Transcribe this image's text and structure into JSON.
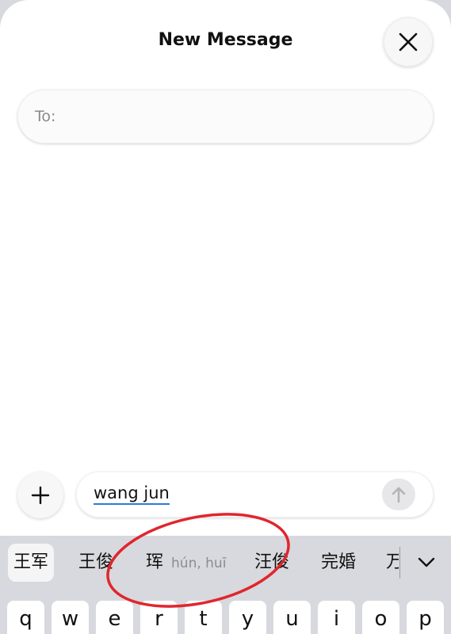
{
  "header": {
    "title": "New Message",
    "close_icon": "close-icon"
  },
  "recipient": {
    "label": "To:"
  },
  "composer": {
    "plus_icon": "plus-icon",
    "text": "wang jun",
    "send_icon": "arrow-up-icon"
  },
  "keyboard": {
    "candidates": [
      {
        "text": "王军",
        "pinyin": ""
      },
      {
        "text": "王俊",
        "pinyin": ""
      },
      {
        "text": "珲",
        "pinyin": "hún, huī"
      },
      {
        "text": "汪俊",
        "pinyin": ""
      },
      {
        "text": "完婚",
        "pinyin": ""
      },
      {
        "text": "万",
        "pinyin": ""
      }
    ],
    "expand_icon": "chevron-down-icon",
    "row1": [
      "q",
      "w",
      "e",
      "r",
      "t",
      "y",
      "u",
      "i",
      "o",
      "p"
    ]
  },
  "colors": {
    "annotation": "#e0262e",
    "underline": "#2d7bd6",
    "keyboard_bg": "#d7d9de"
  }
}
